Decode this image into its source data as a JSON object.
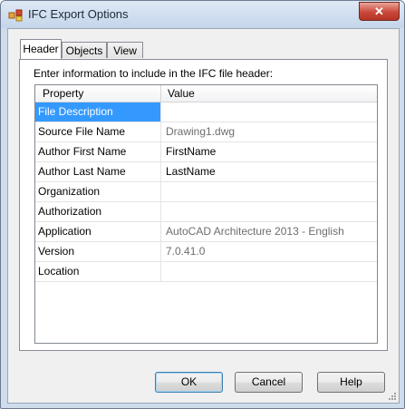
{
  "window": {
    "title": "IFC Export Options",
    "close_glyph": "✕",
    "icon": "ifc-export-icon"
  },
  "tabs": [
    {
      "label": "Header",
      "active": true
    },
    {
      "label": "Objects",
      "active": false
    },
    {
      "label": "View",
      "active": false
    }
  ],
  "header_tab": {
    "instruction": "Enter information to include in the IFC file header:",
    "columns": {
      "property": "Property",
      "value": "Value"
    },
    "rows": [
      {
        "property": "File Description",
        "value": "",
        "selected": true,
        "readonly": false
      },
      {
        "property": "Source File Name",
        "value": "Drawing1.dwg",
        "readonly": true
      },
      {
        "property": "Author First Name",
        "value": "FirstName",
        "readonly": false
      },
      {
        "property": "Author Last Name",
        "value": "LastName",
        "readonly": false
      },
      {
        "property": "Organization",
        "value": "",
        "readonly": false
      },
      {
        "property": "Authorization",
        "value": "",
        "readonly": false
      },
      {
        "property": "Application",
        "value": "AutoCAD Architecture 2013 - English",
        "readonly": true
      },
      {
        "property": "Version",
        "value": "7.0.41.0",
        "readonly": true
      },
      {
        "property": "Location",
        "value": "",
        "readonly": false
      }
    ]
  },
  "buttons": {
    "ok": "OK",
    "cancel": "Cancel",
    "help": "Help"
  },
  "colors": {
    "selection": "#3399ff",
    "readonly_text": "#6d6d6d"
  }
}
